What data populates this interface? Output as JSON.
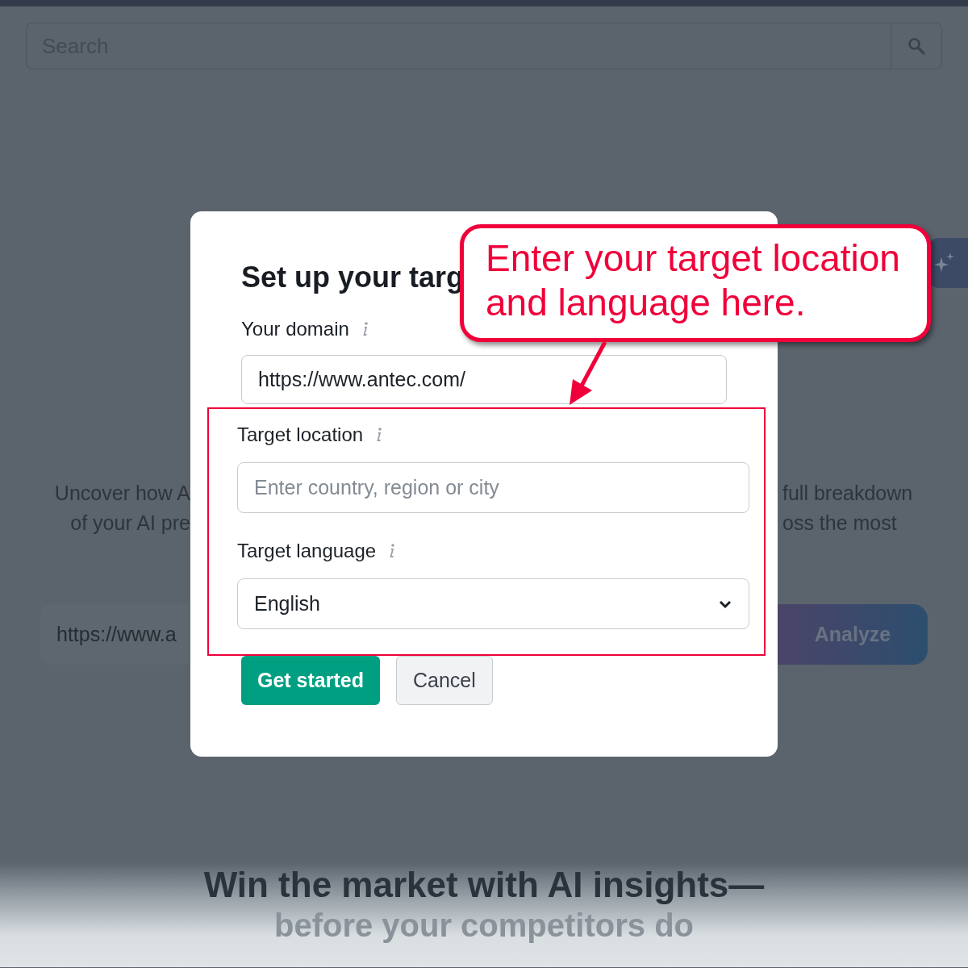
{
  "search": {
    "placeholder": "Search"
  },
  "background": {
    "intro_left": [
      "Uncover how A",
      "of your AI pre"
    ],
    "intro_right": [
      "full breakdown",
      "oss the most"
    ],
    "url_field": {
      "value": "https://www.a"
    },
    "analyze_button": "Analyze",
    "heading": "Win the market with AI insights—",
    "subheading": "before your competitors do"
  },
  "dialog": {
    "title": "Set up your targ",
    "fields": [
      {
        "kind": "text",
        "label": "Your domain",
        "value": "https://www.antec.com/"
      },
      {
        "kind": "text",
        "label": "Target location",
        "placeholder": "Enter country, region or city"
      },
      {
        "kind": "select",
        "label": "Target language",
        "value": "English"
      }
    ],
    "buttons": [
      {
        "kind": "primary",
        "label": "Get started"
      },
      {
        "kind": "secondary",
        "label": "Cancel"
      }
    ]
  },
  "callout": {
    "text": "Enter your target location and language here."
  }
}
